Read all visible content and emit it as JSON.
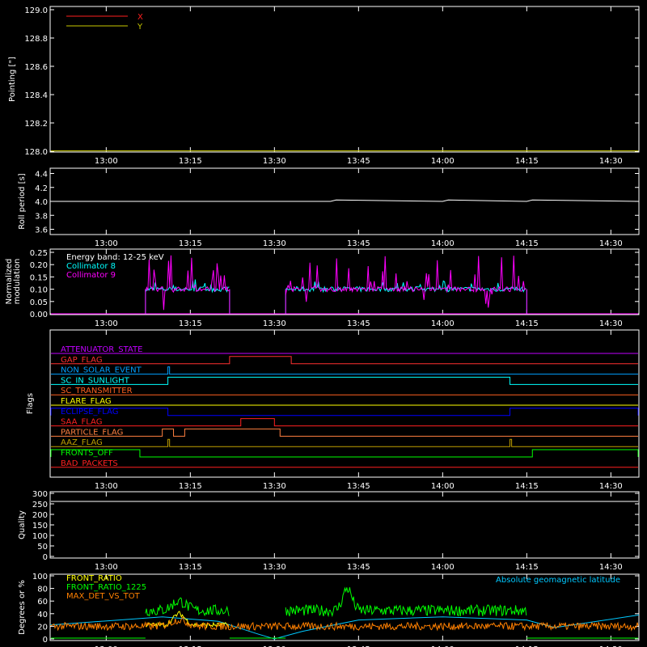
{
  "time_ticks": [
    "13:00",
    "13:15",
    "13:30",
    "13:45",
    "14:00",
    "14:15",
    "14:30"
  ],
  "colors": {
    "background": "#000000",
    "axes": "#ffffff",
    "x": "#ff2020",
    "y": "#c8c800",
    "coll8": "#00ffff",
    "coll9": "#ff00ff",
    "front_ratio": "#ffff00",
    "front_ratio_1225": "#00ff00",
    "max_det": "#ff8000",
    "geolat": "#00c8ff"
  },
  "chart_data": [
    {
      "type": "line",
      "panel": "pointing",
      "ylabel": "Pointing [\"]",
      "ylim": [
        128.0,
        129.0
      ],
      "yticks": [
        "129.0",
        "128.8",
        "128.6",
        "128.4",
        "128.2",
        "128.0"
      ],
      "series": [
        {
          "name": "X",
          "color": "#ff2020",
          "x": [
            "12:50",
            "14:35"
          ],
          "y": [
            128.0,
            128.0
          ]
        },
        {
          "name": "Y",
          "color": "#c8c800",
          "x": [
            "12:50",
            "14:35"
          ],
          "y": [
            128.0,
            128.0
          ]
        }
      ]
    },
    {
      "type": "line",
      "panel": "roll",
      "ylabel": "Roll period [s]",
      "ylim": [
        3.5,
        4.5
      ],
      "yticks": [
        "4.4",
        "4.2",
        "4.0",
        "3.8",
        "3.6"
      ],
      "series": [
        {
          "x": [
            "12:50",
            "13:40",
            "13:41",
            "14:00",
            "14:01",
            "14:15",
            "14:16",
            "14:35"
          ],
          "y": [
            4.0,
            4.0,
            4.02,
            4.0,
            4.02,
            4.0,
            4.02,
            4.0
          ]
        }
      ]
    },
    {
      "type": "line",
      "panel": "modulation",
      "ylabel": "Normalized modulation",
      "ylim": [
        0,
        0.25
      ],
      "yticks": [
        "0.25",
        "0.20",
        "0.15",
        "0.10",
        "0.05",
        "0.00"
      ],
      "annotation": "Energy band: 12-25 keV",
      "series": [
        {
          "name": "Collimator 8",
          "color": "#00ffff",
          "segments": [
            [
              "13:07",
              "13:22"
            ],
            [
              "13:32",
              "14:15"
            ]
          ],
          "level": 0.1,
          "spike_max": 0.14
        },
        {
          "name": "Collimator 9",
          "color": "#ff00ff",
          "segments": [
            [
              "13:07",
              "13:22"
            ],
            [
              "13:32",
              "14:15"
            ]
          ],
          "level": 0.1,
          "spike_max": 0.24
        }
      ]
    },
    {
      "type": "line",
      "panel": "flags",
      "ylabel": "Flags",
      "flags": [
        {
          "name": "ATTENUATOR_STATE",
          "color": "#c000ff",
          "highs": []
        },
        {
          "name": "GAP_FLAG",
          "color": "#ff3030",
          "highs": [
            [
              "13:22",
              "13:33"
            ]
          ]
        },
        {
          "name": "NON_SOLAR_EVENT",
          "color": "#00a0ff",
          "highs": [
            [
              "13:11",
              "13:11.3"
            ]
          ]
        },
        {
          "name": "SC_IN_SUNLIGHT",
          "color": "#00ffff",
          "highs": [
            [
              "13:11",
              "14:12"
            ]
          ]
        },
        {
          "name": "SC_TRANSMITTER",
          "color": "#ff6020",
          "highs": []
        },
        {
          "name": "FLARE_FLAG",
          "color": "#ffff00",
          "highs": []
        },
        {
          "name": "ECLIPSE_FLAG",
          "color": "#0000ff",
          "highs": [
            [
              "12:50",
              "13:11"
            ],
            [
              "14:12",
              "14:35"
            ]
          ]
        },
        {
          "name": "SAA_FLAG",
          "color": "#ff2020",
          "highs": [
            [
              "13:24",
              "13:30"
            ]
          ]
        },
        {
          "name": "PARTICLE_FLAG",
          "color": "#ff8040",
          "highs": [
            [
              "13:10",
              "13:12"
            ],
            [
              "13:14",
              "13:31"
            ]
          ]
        },
        {
          "name": "AAZ_FLAG",
          "color": "#c0a000",
          "highs": [
            [
              "13:11",
              "13:11.3"
            ],
            [
              "14:12",
              "14:12.3"
            ]
          ]
        },
        {
          "name": "FRONTS_OFF",
          "color": "#00ff00",
          "highs": [
            [
              "12:50",
              "13:06"
            ],
            [
              "14:16",
              "14:35"
            ]
          ]
        },
        {
          "name": "BAD_PACKETS",
          "color": "#ff2020",
          "highs": []
        }
      ]
    },
    {
      "type": "line",
      "panel": "quality",
      "ylabel": "Quality",
      "ylim": [
        0,
        310
      ],
      "yticks": [
        "300",
        "250",
        "200",
        "150",
        "100",
        "50",
        "0"
      ],
      "series": []
    },
    {
      "type": "line",
      "panel": "ratios",
      "ylabel": "Degrees or %",
      "ylim": [
        0,
        100
      ],
      "yticks": [
        "100",
        "80",
        "60",
        "40",
        "20",
        "0"
      ],
      "annotation": "Absolute geomagnetic latitude",
      "series": [
        {
          "name": "FRONT_RATIO",
          "color": "#ffff00"
        },
        {
          "name": "FRONT_RATIO_1225",
          "color": "#00ff00"
        },
        {
          "name": "MAX_DET_VS_TOT",
          "color": "#ff8000"
        }
      ]
    }
  ]
}
